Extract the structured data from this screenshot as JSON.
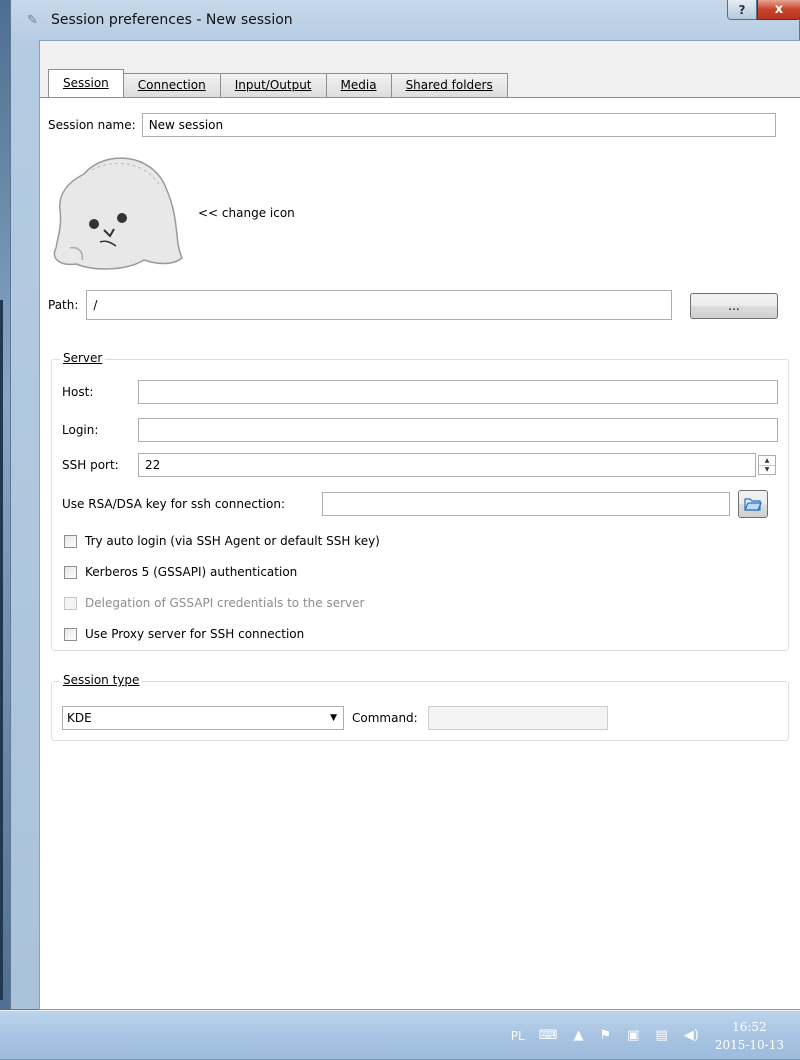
{
  "window": {
    "title": "Session preferences - New session",
    "help_label": "?",
    "close_label": "x"
  },
  "tabs": [
    {
      "label": "Session",
      "active": true
    },
    {
      "label": "Connection",
      "active": false
    },
    {
      "label": "Input/Output",
      "active": false
    },
    {
      "label": "Media",
      "active": false
    },
    {
      "label": "Shared folders",
      "active": false
    }
  ],
  "session": {
    "name_label": "Session name:",
    "name_value": "New session",
    "change_icon_label": "<< change icon",
    "path_label": "Path:",
    "path_value": "/",
    "browse_button": "..."
  },
  "server": {
    "group_title": "Server",
    "host_label": "Host:",
    "host_value": "",
    "login_label": "Login:",
    "login_value": "",
    "ssh_port_label": "SSH port:",
    "ssh_port_value": "22",
    "rsa_label": "Use RSA/DSA key for ssh connection:",
    "rsa_value": "",
    "checkboxes": [
      {
        "label": "Try auto login (via SSH Agent or default SSH key)",
        "checked": false,
        "enabled": true
      },
      {
        "label": "Kerberos 5 (GSSAPI) authentication",
        "checked": false,
        "enabled": true
      },
      {
        "label": "Delegation of GSSAPI credentials to the server",
        "checked": false,
        "enabled": false
      },
      {
        "label": "Use Proxy server for SSH connection",
        "checked": false,
        "enabled": true
      }
    ]
  },
  "session_type": {
    "group_title": "Session type",
    "selected": "KDE",
    "command_label": "Command:",
    "command_value": ""
  },
  "taskbar": {
    "language": "PL",
    "time": "16:52",
    "date": "2015-10-13"
  }
}
